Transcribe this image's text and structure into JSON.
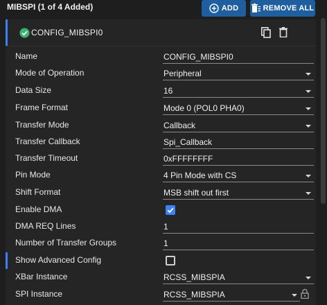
{
  "header": {
    "title": "MIBSPI (1 of 4 Added)",
    "add_label": "ADD",
    "remove_all_label": "REMOVE ALL"
  },
  "instance": {
    "name": "CONFIG_MIBSPI0",
    "status": "valid"
  },
  "fields": {
    "name": {
      "label": "Name",
      "value": "CONFIG_MIBSPI0"
    },
    "mode_of_operation": {
      "label": "Mode of Operation",
      "value": "Peripheral"
    },
    "data_size": {
      "label": "Data Size",
      "value": "16"
    },
    "frame_format": {
      "label": "Frame Format",
      "value": "Mode 0 (POL0 PHA0)"
    },
    "transfer_mode": {
      "label": "Transfer Mode",
      "value": "Callback"
    },
    "transfer_callback": {
      "label": "Transfer Callback",
      "value": "Spi_Callback"
    },
    "transfer_timeout": {
      "label": "Transfer Timeout",
      "value": "0xFFFFFFFF"
    },
    "pin_mode": {
      "label": "Pin Mode",
      "value": "4 Pin Mode with CS"
    },
    "shift_format": {
      "label": "Shift Format",
      "value": "MSB shift out first"
    },
    "enable_dma": {
      "label": "Enable DMA",
      "checked": true
    },
    "dma_req_lines": {
      "label": "DMA REQ Lines",
      "value": "1"
    },
    "number_of_transfer_groups": {
      "label": "Number of Transfer Groups",
      "value": "1"
    },
    "show_advanced_config": {
      "label": "Show Advanced Config",
      "checked": false
    },
    "xbar_instance": {
      "label": "XBar Instance",
      "value": "RCSS_MIBSPIA"
    },
    "spi_instance": {
      "label": "SPI Instance",
      "value": "RCSS_MIBSPIA"
    }
  },
  "colors": {
    "accent": "#3b82f6",
    "button": "#1f5fa0",
    "valid": "#3cb371"
  },
  "icons": [
    "add-circle-icon",
    "remove-all-icon",
    "check-circle-icon",
    "copy-icon",
    "trash-icon",
    "chevron-down-icon",
    "lock-icon",
    "checkbox-checked-icon"
  ]
}
